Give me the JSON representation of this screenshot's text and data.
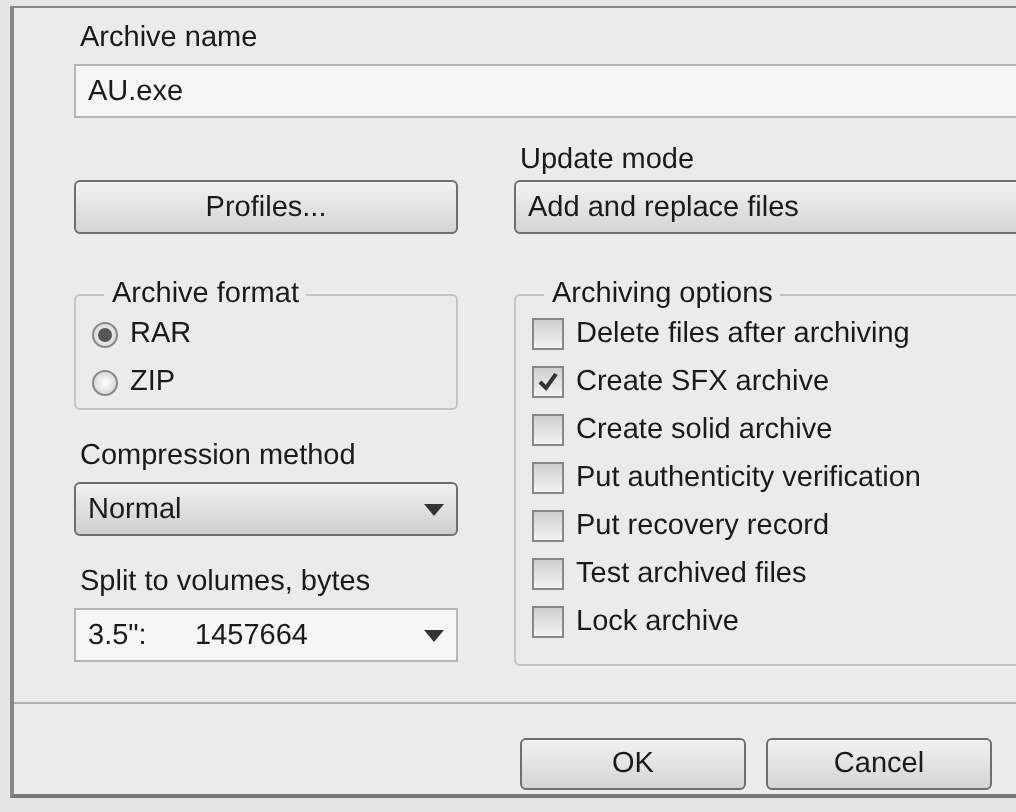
{
  "archive_name": {
    "label": "Archive name",
    "value": "AU.exe"
  },
  "profiles_button": {
    "label": "Profiles..."
  },
  "update_mode": {
    "label": "Update mode",
    "value": "Add and replace files"
  },
  "archive_format": {
    "title": "Archive format",
    "options": [
      {
        "label": "RAR",
        "selected": true
      },
      {
        "label": "ZIP",
        "selected": false
      }
    ]
  },
  "compression_method": {
    "label": "Compression method",
    "value": "Normal"
  },
  "split_to_volumes": {
    "label": "Split to volumes, bytes",
    "value": "3.5\":      1457664"
  },
  "archiving_options": {
    "title": "Archiving options",
    "options": [
      {
        "label": "Delete files after archiving",
        "checked": false
      },
      {
        "label": "Create SFX archive",
        "checked": true
      },
      {
        "label": "Create solid archive",
        "checked": false
      },
      {
        "label": "Put authenticity verification",
        "checked": false
      },
      {
        "label": "Put recovery record",
        "checked": false
      },
      {
        "label": "Test archived files",
        "checked": false
      },
      {
        "label": "Lock archive",
        "checked": false
      }
    ]
  },
  "buttons": [
    {
      "label": "OK"
    },
    {
      "label": "Cancel"
    }
  ]
}
